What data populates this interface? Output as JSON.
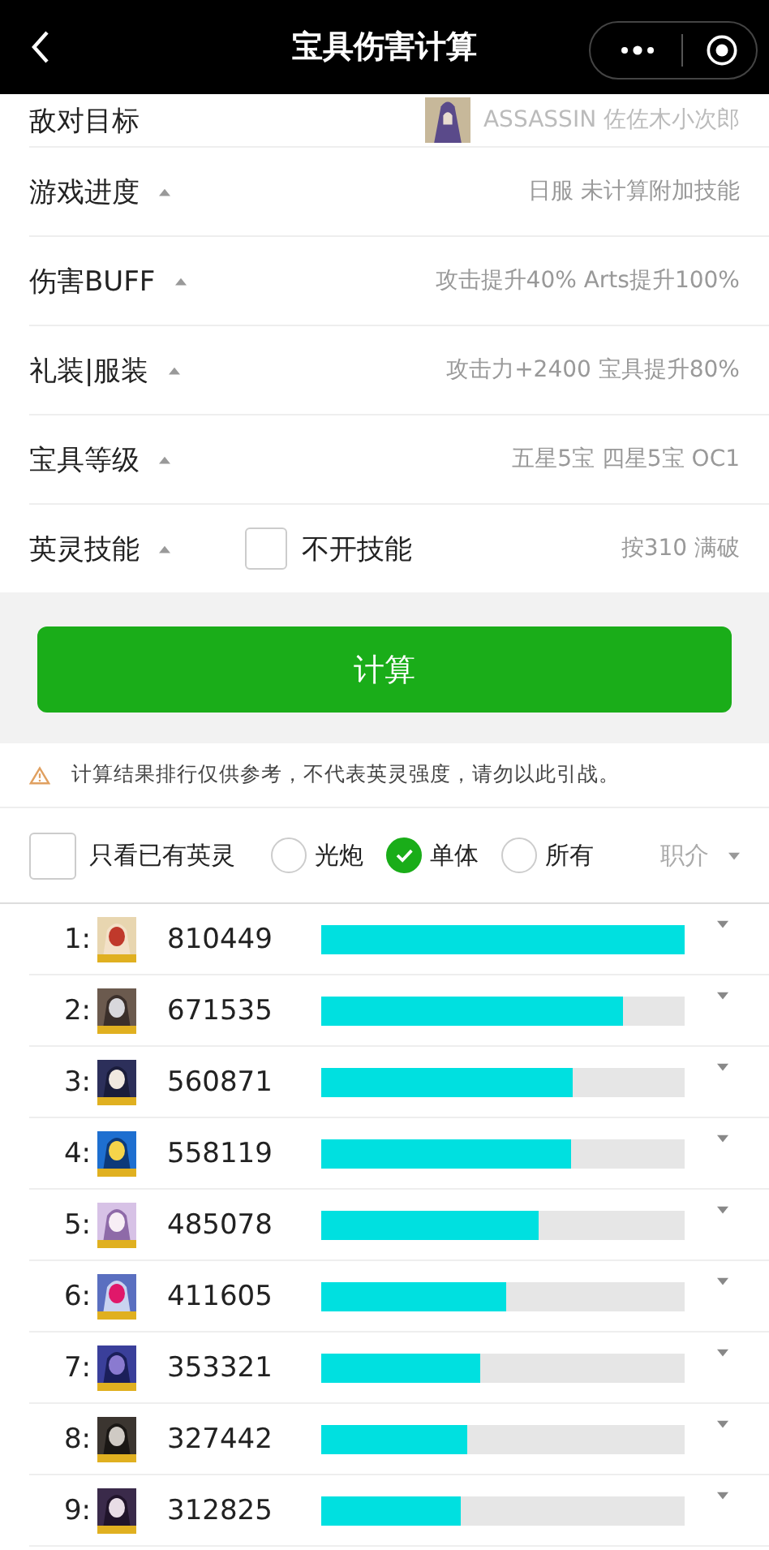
{
  "header": {
    "title": "宝具伤害计算"
  },
  "settings": [
    {
      "kind": "target",
      "label": "敌对目标",
      "value": "ASSASSIN 佐佐木小次郎"
    },
    {
      "kind": "select",
      "label": "游戏进度",
      "value": "日服 未计算附加技能"
    },
    {
      "kind": "select",
      "label": "伤害BUFF",
      "value": "攻击提升40% Arts提升100%"
    },
    {
      "kind": "select",
      "label": "礼装|服装",
      "value": "攻击力+2400 宝具提升80%"
    },
    {
      "kind": "select",
      "label": "宝具等级",
      "value": "五星5宝 四星5宝 OC1"
    },
    {
      "kind": "skill",
      "label": "英灵技能",
      "checkbox": {
        "label": "不开技能",
        "checked": false
      },
      "value": "按310 满破"
    }
  ],
  "calculate_button": "计算",
  "notice": "计算结果排行仅供参考，不代表英灵强度，请勿以此引战。",
  "filters": {
    "owned_only": {
      "label": "只看已有英灵",
      "checked": false
    },
    "modes": [
      {
        "label": "光炮",
        "selected": false
      },
      {
        "label": "单体",
        "selected": true
      },
      {
        "label": "所有",
        "selected": false
      }
    ],
    "class_select": "职介"
  },
  "ranking": [
    {
      "rank": "1:",
      "damage": "810449",
      "level": 1.0
    },
    {
      "rank": "2:",
      "damage": "671535",
      "level": 0.829
    },
    {
      "rank": "3:",
      "damage": "560871",
      "level": 0.692
    },
    {
      "rank": "4:",
      "damage": "558119",
      "level": 0.689
    },
    {
      "rank": "5:",
      "damage": "485078",
      "level": 0.598
    },
    {
      "rank": "6:",
      "damage": "411605",
      "level": 0.508
    },
    {
      "rank": "7:",
      "damage": "353321",
      "level": 0.436
    },
    {
      "rank": "8:",
      "damage": "327442",
      "level": 0.404
    },
    {
      "rank": "9:",
      "damage": "312825",
      "level": 0.386
    }
  ]
}
